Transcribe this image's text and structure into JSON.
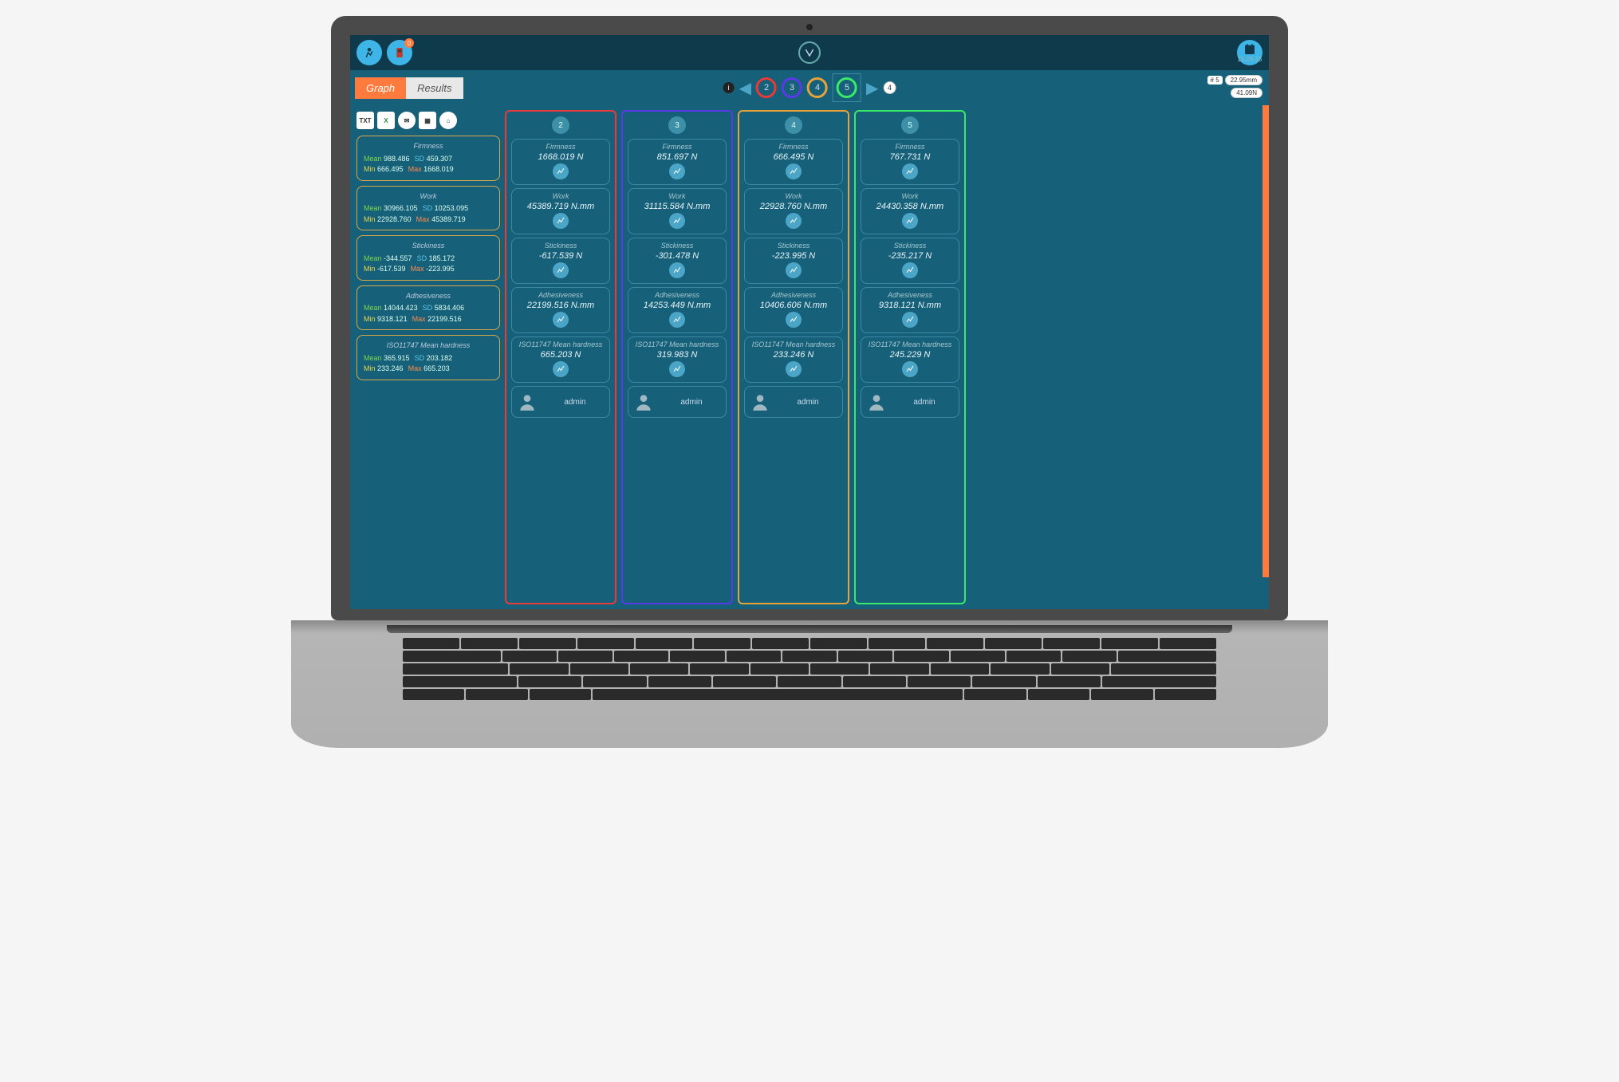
{
  "header": {
    "notif_count": "0",
    "time": "15:25:15"
  },
  "tabs": {
    "graph": "Graph",
    "results": "Results"
  },
  "sampleNav": {
    "ids": [
      "2",
      "3",
      "4",
      "5"
    ],
    "colors": [
      "#e83a3a",
      "#5a3ae8",
      "#e8a23a",
      "#3ae86a"
    ],
    "selectedIndex": 3,
    "count_after": "4"
  },
  "readout": {
    "sample_label": "# 5",
    "dist": "22.95mm",
    "force": "41.09N"
  },
  "export": {
    "txt": "TXT",
    "xls": "X",
    "mail": "✉",
    "doc": "▦",
    "home": "⌂"
  },
  "stats": [
    {
      "title": "Firmness",
      "mean": "988.486",
      "sd": "459.307",
      "min": "666.495",
      "max": "1668.019"
    },
    {
      "title": "Work",
      "mean": "30966.105",
      "sd": "10253.095",
      "min": "22928.760",
      "max": "45389.719"
    },
    {
      "title": "Stickiness",
      "mean": "-344.557",
      "sd": "185.172",
      "min": "-617.539",
      "max": "-223.995"
    },
    {
      "title": "Adhesiveness",
      "mean": "14044.423",
      "sd": "5834.406",
      "min": "9318.121",
      "max": "22199.516"
    },
    {
      "title": "ISO11747 Mean hardness",
      "mean": "365.915",
      "sd": "203.182",
      "min": "233.246",
      "max": "665.203"
    }
  ],
  "labels": {
    "mean": "Mean",
    "sd": "SD",
    "min": "Min",
    "max": "Max"
  },
  "metricTitles": {
    "firmness": "Firmness",
    "work": "Work",
    "stickiness": "Stickiness",
    "adhesiveness": "Adhesiveness",
    "iso": "ISO11747 Mean hardness"
  },
  "samples": [
    {
      "id": "2",
      "color": "#e83a3a",
      "user": "admin",
      "firmness": "1668.019 N",
      "work": "45389.719 N.mm",
      "stickiness": "-617.539 N",
      "adhesiveness": "22199.516 N.mm",
      "iso": "665.203 N"
    },
    {
      "id": "3",
      "color": "#5a3ae8",
      "user": "admin",
      "firmness": "851.697 N",
      "work": "31115.584 N.mm",
      "stickiness": "-301.478 N",
      "adhesiveness": "14253.449 N.mm",
      "iso": "319.983 N"
    },
    {
      "id": "4",
      "color": "#e8a23a",
      "user": "admin",
      "firmness": "666.495 N",
      "work": "22928.760 N.mm",
      "stickiness": "-223.995 N",
      "adhesiveness": "10406.606 N.mm",
      "iso": "233.246 N"
    },
    {
      "id": "5",
      "color": "#3ae86a",
      "user": "admin",
      "firmness": "767.731 N",
      "work": "24430.358 N.mm",
      "stickiness": "-235.217 N",
      "adhesiveness": "9318.121 N.mm",
      "iso": "245.229 N"
    }
  ]
}
